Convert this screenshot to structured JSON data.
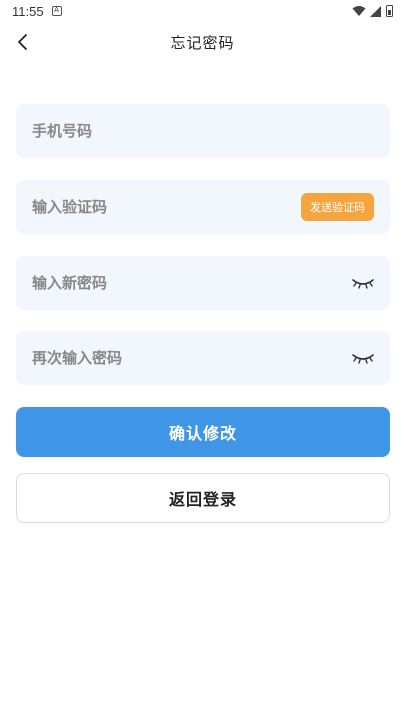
{
  "status_bar": {
    "time": "11:55",
    "notification_icon": "A"
  },
  "header": {
    "title": "忘记密码",
    "back_icon": "chevron-left-icon"
  },
  "form": {
    "phone": {
      "placeholder": "手机号码",
      "value": ""
    },
    "code": {
      "placeholder": "输入验证码",
      "value": "",
      "send_label": "发送验证码"
    },
    "new_password": {
      "placeholder": "输入新密码",
      "value": ""
    },
    "confirm_password": {
      "placeholder": "再次输入密码",
      "value": ""
    }
  },
  "actions": {
    "confirm_label": "确认修改",
    "back_login_label": "返回登录"
  },
  "colors": {
    "primary": "#4096e6",
    "accent": "#f5a53f",
    "field_bg": "#f2f7fd"
  }
}
